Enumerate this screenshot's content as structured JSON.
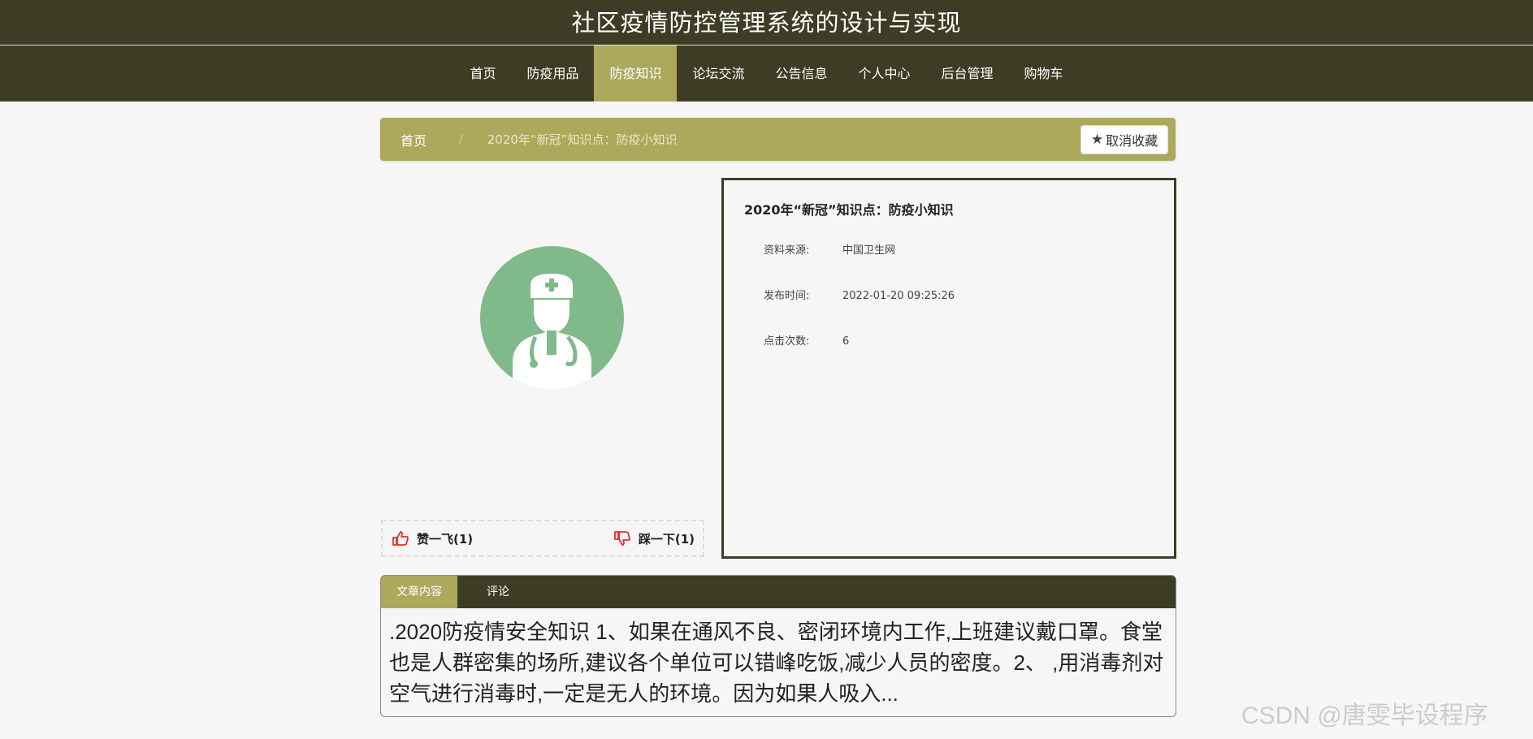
{
  "header": {
    "title": "社区疫情防控管理系统的设计与实现"
  },
  "nav": {
    "items": [
      "首页",
      "防疫用品",
      "防疫知识",
      "论坛交流",
      "公告信息",
      "个人中心",
      "后台管理",
      "购物车"
    ],
    "active_index": 2
  },
  "breadcrumb": {
    "home": "首页",
    "separator": "/",
    "current": "2020年“新冠”知识点：防疫小知识"
  },
  "favorite": {
    "label": "取消收藏",
    "icon": "star-icon"
  },
  "avatar": {
    "icon": "doctor-icon",
    "bg_color": "#80b98a"
  },
  "votes": {
    "like": {
      "label": "赞一飞(1)",
      "icon": "thumbs-up-icon"
    },
    "dislike": {
      "label": "踩一下(1)",
      "icon": "thumbs-down-icon"
    }
  },
  "info": {
    "title": "2020年“新冠”知识点：防疫小知识",
    "source_label": "资料来源:",
    "source_value": "中国卫生网",
    "time_label": "发布时间:",
    "time_value": "2022-01-20 09:25:26",
    "clicks_label": "点击次数:",
    "clicks_value": "6"
  },
  "tabs": {
    "items": [
      "文章内容",
      "评论"
    ],
    "active_index": 0
  },
  "article": {
    "text": ".2020防疫情安全知识 1、如果在通风不良、密闭环境内工作,上班建议戴口罩。食堂也是人群密集的场所,建议各个单位可以错峰吃饭,减少人员的密度。2、 ,用消毒剂对空气进行消毒时,一定是无人的环境。因为如果人吸入..."
  },
  "watermark": "CSDN @唐雯毕设程序",
  "colors": {
    "primary": "#3d3d25",
    "accent": "#ada95c",
    "background": "#f6f6f6",
    "icon_red": "#e0302b"
  }
}
